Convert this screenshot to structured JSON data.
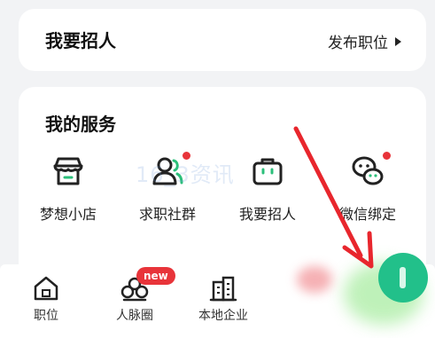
{
  "recruit_card": {
    "title": "我要招人",
    "action": "发布职位"
  },
  "services": {
    "title": "我的服务",
    "items": [
      {
        "label": "梦想小店",
        "icon": "shop-icon",
        "dot": false
      },
      {
        "label": "求职社群",
        "icon": "community-icon",
        "dot": true
      },
      {
        "label": "我要招人",
        "icon": "briefcase-icon",
        "dot": false
      },
      {
        "label": "微信绑定",
        "icon": "wechat-icon",
        "dot": true
      }
    ]
  },
  "watermark": "16_3资讯",
  "tabbar": {
    "items": [
      {
        "label": "职位",
        "icon": "home-icon"
      },
      {
        "label": "人脉圈",
        "icon": "network-icon"
      },
      {
        "label": "本地企业",
        "icon": "building-icon"
      }
    ],
    "badge": "new"
  },
  "colors": {
    "accent_red": "#e8343a",
    "accent_green": "#22c08a"
  }
}
